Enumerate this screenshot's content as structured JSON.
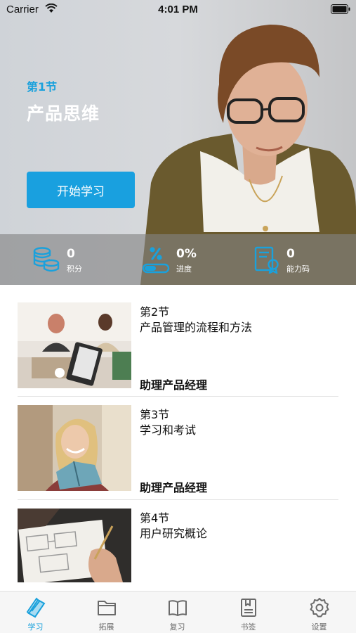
{
  "status_bar": {
    "carrier": "Carrier",
    "time": "4:01 PM"
  },
  "hero": {
    "lesson_number": "第1节",
    "lesson_title": "产品思维",
    "start_button": "开始学习",
    "stats": [
      {
        "icon": "coins-icon",
        "value": "0",
        "label": "积分"
      },
      {
        "icon": "progress-icon",
        "value": "0%",
        "label": "进度"
      },
      {
        "icon": "certificate-icon",
        "value": "0",
        "label": "能力码"
      }
    ]
  },
  "lessons": [
    {
      "section": "第2节",
      "title": "产品管理的流程和方法",
      "level": "助理产品经理"
    },
    {
      "section": "第3节",
      "title": "学习和考试",
      "level": "助理产品经理"
    },
    {
      "section": "第4节",
      "title": "用户研究概论",
      "level": ""
    }
  ],
  "tabs": [
    {
      "icon": "book-icon",
      "label": "学习",
      "active": true
    },
    {
      "icon": "folder-icon",
      "label": "拓展",
      "active": false
    },
    {
      "icon": "open-book-icon",
      "label": "复习",
      "active": false
    },
    {
      "icon": "bookmark-icon",
      "label": "书签",
      "active": false
    },
    {
      "icon": "gear-icon",
      "label": "设置",
      "active": false
    }
  ],
  "colors": {
    "accent": "#1aa1dc",
    "button": "#19a0df",
    "text": "#111111",
    "tab_inactive": "#6a6a6a"
  }
}
